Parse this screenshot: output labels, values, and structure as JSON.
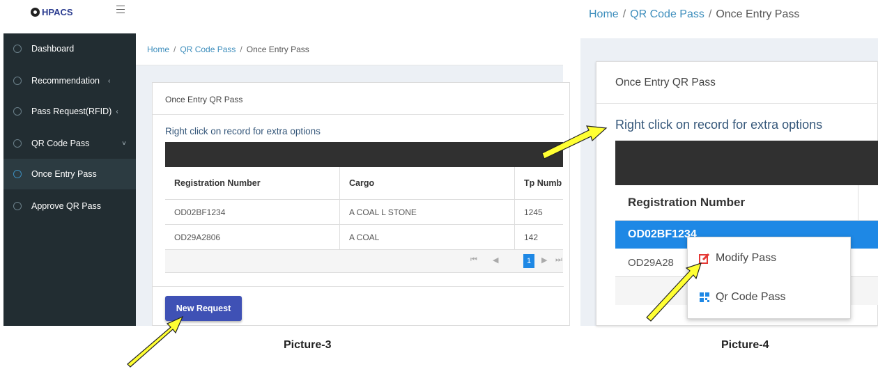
{
  "picture3": {
    "brand": "HPACS",
    "sidebar": {
      "items": [
        {
          "label": "Dashboard",
          "caret": ""
        },
        {
          "label": "Recommendation",
          "caret": "‹"
        },
        {
          "label": "Pass Request(RFID)",
          "caret": "‹"
        },
        {
          "label": "QR Code Pass",
          "caret": "˅"
        },
        {
          "label": "Once Entry Pass",
          "caret": ""
        },
        {
          "label": "Approve QR Pass",
          "caret": ""
        }
      ],
      "active_item": "Once Entry Pass"
    },
    "breadcrumb": {
      "home": "Home",
      "section": "QR Code Pass",
      "current": "Once Entry Pass",
      "separator": "/"
    },
    "card_title": "Once Entry QR Pass",
    "hint": "Right click on record for extra options",
    "table": {
      "columns": [
        "Registration Number",
        "Cargo",
        "Tp Numb"
      ],
      "rows": [
        [
          "OD02BF1234",
          "A COAL L STONE",
          "1245"
        ],
        [
          "OD29A2806",
          "A COAL",
          "142"
        ]
      ]
    },
    "pager": {
      "first": "⏮",
      "prev": "◀",
      "page": "1",
      "next": "▶",
      "last": "⏭"
    },
    "new_request_label": "New Request",
    "caption": "Picture-3"
  },
  "picture4": {
    "breadcrumb": {
      "home": "Home",
      "section": "QR Code Pass",
      "current": "Once Entry Pass",
      "separator": "/"
    },
    "card_title": "Once Entry QR Pass",
    "hint": "Right click on record for extra options",
    "table": {
      "columns": [
        "Registration Number"
      ],
      "rows": [
        "OD02BF1234",
        "OD29A28"
      ]
    },
    "context_menu": [
      {
        "label": "Modify Pass",
        "icon": "edit-icon"
      },
      {
        "label": "Qr Code Pass",
        "icon": "qr-code-icon"
      }
    ],
    "caption": "Picture-4"
  },
  "colors": {
    "sidebar_bg": "#222d32",
    "selected_row": "#1e88e5",
    "button": "#3f51b5",
    "link": "#3c8dbc",
    "arrow_fill": "#ffff33"
  }
}
